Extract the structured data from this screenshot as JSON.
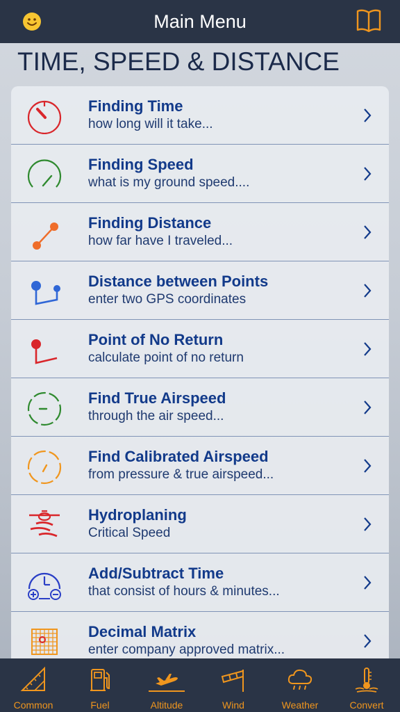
{
  "header": {
    "title": "Main Menu",
    "left_icon": "smiley-icon",
    "right_icon": "book-icon"
  },
  "section": {
    "title": "TIME, SPEED & DISTANCE"
  },
  "menu": [
    {
      "title": "Finding Time",
      "subtitle": "how long will it take...",
      "icon": "stopwatch-icon",
      "color": "#d9262b"
    },
    {
      "title": "Finding Speed",
      "subtitle": "what is my ground speed....",
      "icon": "speedometer-icon",
      "color": "#2f8a2f"
    },
    {
      "title": "Finding Distance",
      "subtitle": "how far have I traveled...",
      "icon": "distance-icon",
      "color": "#ef6d2a"
    },
    {
      "title": "Distance between Points",
      "subtitle": "enter two GPS coordinates",
      "icon": "gps-points-icon",
      "color": "#2f66d6"
    },
    {
      "title": "Point of No Return",
      "subtitle": "calculate point of no return",
      "icon": "no-return-icon",
      "color": "#d9262b"
    },
    {
      "title": "Find True Airspeed",
      "subtitle": "through the air speed...",
      "icon": "true-airspeed-icon",
      "color": "#2f8a2f"
    },
    {
      "title": "Find Calibrated Airspeed",
      "subtitle": "from pressure & true airspeed...",
      "icon": "calibrated-airspeed-icon",
      "color": "#f0961e"
    },
    {
      "title": "Hydroplaning",
      "subtitle": "Critical Speed",
      "icon": "hydroplaning-icon",
      "color": "#d9262b"
    },
    {
      "title": "Add/Subtract Time",
      "subtitle": "that consist of hours & minutes...",
      "icon": "clock-add-subtract-icon",
      "color": "#2a3fc6"
    },
    {
      "title": "Decimal Matrix",
      "subtitle": "enter company approved matrix...",
      "icon": "matrix-grid-icon",
      "color": "#f0961e"
    }
  ],
  "tabs": [
    {
      "label": "Common",
      "icon": "ruler-triangle-icon"
    },
    {
      "label": "Fuel",
      "icon": "fuel-pump-icon"
    },
    {
      "label": "Altitude",
      "icon": "airplane-takeoff-icon",
      "selected": true
    },
    {
      "label": "Wind",
      "icon": "windsock-icon"
    },
    {
      "label": "Weather",
      "icon": "rain-cloud-icon"
    },
    {
      "label": "Convert",
      "icon": "temperature-icon"
    }
  ],
  "colors": {
    "bar": "#2a3446",
    "accent": "#f0961e",
    "title_text": "#123a8a"
  }
}
